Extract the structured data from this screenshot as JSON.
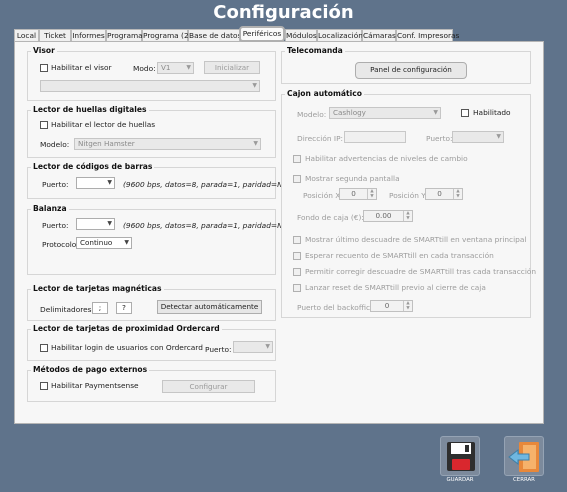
{
  "window": {
    "title": "Configuración"
  },
  "tabs": [
    {
      "label": "Local"
    },
    {
      "label": "Ticket"
    },
    {
      "label": "Informes"
    },
    {
      "label": "Programa"
    },
    {
      "label": "Programa (2)"
    },
    {
      "label": "Base de datos"
    },
    {
      "label": "Periféricos"
    },
    {
      "label": "Módulos"
    },
    {
      "label": "Localización"
    },
    {
      "label": "Cámaras"
    },
    {
      "label": "Conf. Impresoras"
    }
  ],
  "active_tab": "Periféricos",
  "colors": {
    "background": "#5f738b",
    "highlight": "#22b14c",
    "panel": "#f7f7f7"
  },
  "visor": {
    "title": "Visor",
    "enable_label": "Habilitar el visor",
    "mode_label": "Modo:",
    "mode_value": "V1",
    "init_button": "Inicializar",
    "port_value": ""
  },
  "fingerprint": {
    "title": "Lector de huellas digitales",
    "enable_label": "Habilitar el lector de huellas",
    "model_label": "Modelo:",
    "model_value": "Nitgen Hamster"
  },
  "barcode": {
    "title": "Lector de códigos de barras",
    "port_label": "Puerto:",
    "port_value": "",
    "port_info": "(9600 bps, datos=8, parada=1, paridad=No)"
  },
  "scale": {
    "title": "Balanza",
    "port_label": "Puerto:",
    "port_value": "",
    "port_info": "(9600 bps, datos=8, parada=1, paridad=No)",
    "protocol_label": "Protocolo:",
    "protocol_value": "Continuo"
  },
  "magnetic": {
    "title": "Lector de tarjetas magnéticas",
    "delimiters_label": "Delimitadores:",
    "delimiter_1": ";",
    "delimiter_2": "?",
    "detect_button": "Detectar automáticamente"
  },
  "ordercard": {
    "title": "Lector de tarjetas de proximidad Ordercard",
    "enable_label": "Habilitar login de usuarios con Ordercard",
    "port_label": "Puerto:",
    "port_value": ""
  },
  "payment": {
    "title": "Métodos de pago externos",
    "enable_label": "Habilitar Paymentsense",
    "config_button": "Configurar"
  },
  "remote": {
    "title": "Telecomanda",
    "panel_button": "Panel de configuración"
  },
  "cash": {
    "title": "Cajon automático",
    "model_label": "Modelo:",
    "model_value": "Cashlogy",
    "enabled_label": "Habilitado",
    "ip_label": "Dirección IP:",
    "ip_value": "",
    "port_label": "Puerto:",
    "port_value": "",
    "warn_label": "Habilitar advertencias de niveles de cambio",
    "second_screen_label": "Mostrar segunda pantalla",
    "pos_x_label": "Posición X:",
    "pos_x_value": "0",
    "pos_y_label": "Posición Y:",
    "pos_y_value": "0",
    "fund_label": "Fondo de caja (€):",
    "fund_value": "0.00",
    "opt1": "Mostrar último descuadre de SMARTtill en ventana principal",
    "opt2": "Esperar recuento de SMARTtill en cada transacción",
    "opt3": "Permitir corregir descuadre de SMARTtill tras cada transacción",
    "opt4": "Lanzar reset de SMARTtill previo al cierre de caja",
    "backoffice_label": "Puerto del backoffice:",
    "backoffice_value": "0"
  },
  "actions": {
    "save": "GUARDAR",
    "close": "CERRAR"
  }
}
